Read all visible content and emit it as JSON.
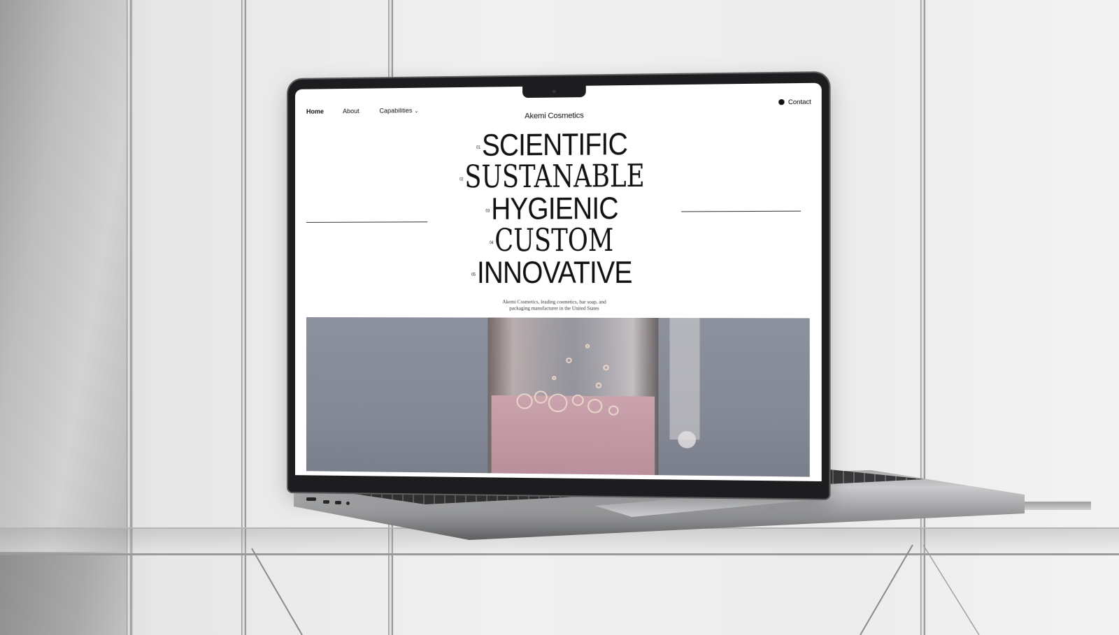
{
  "nav": {
    "home": "Home",
    "about": "About",
    "capabilities": "Capabilities",
    "contact": "Contact"
  },
  "brand": "Akemi Cosmetics",
  "headline": [
    {
      "num": "01",
      "word": "SCIENTIFIC"
    },
    {
      "num": "02",
      "word": "SUSTANABLE"
    },
    {
      "num": "03",
      "word": "HYGIENIC"
    },
    {
      "num": "04",
      "word": "CUSTOM"
    },
    {
      "num": "05",
      "word": "INNOVATIVE"
    }
  ],
  "tagline": "Akemi Cosmetics, leading cosmetics, bar soap, and packaging manufacturer in the United States",
  "colors": {
    "page_bg": "#ffffff",
    "text": "#111111",
    "hero_bg": "#868b97",
    "liquid": "#c9a0ac"
  },
  "icons": {
    "capabilities_dropdown": "chevron-down-icon",
    "contact_marker": "dot-icon"
  }
}
